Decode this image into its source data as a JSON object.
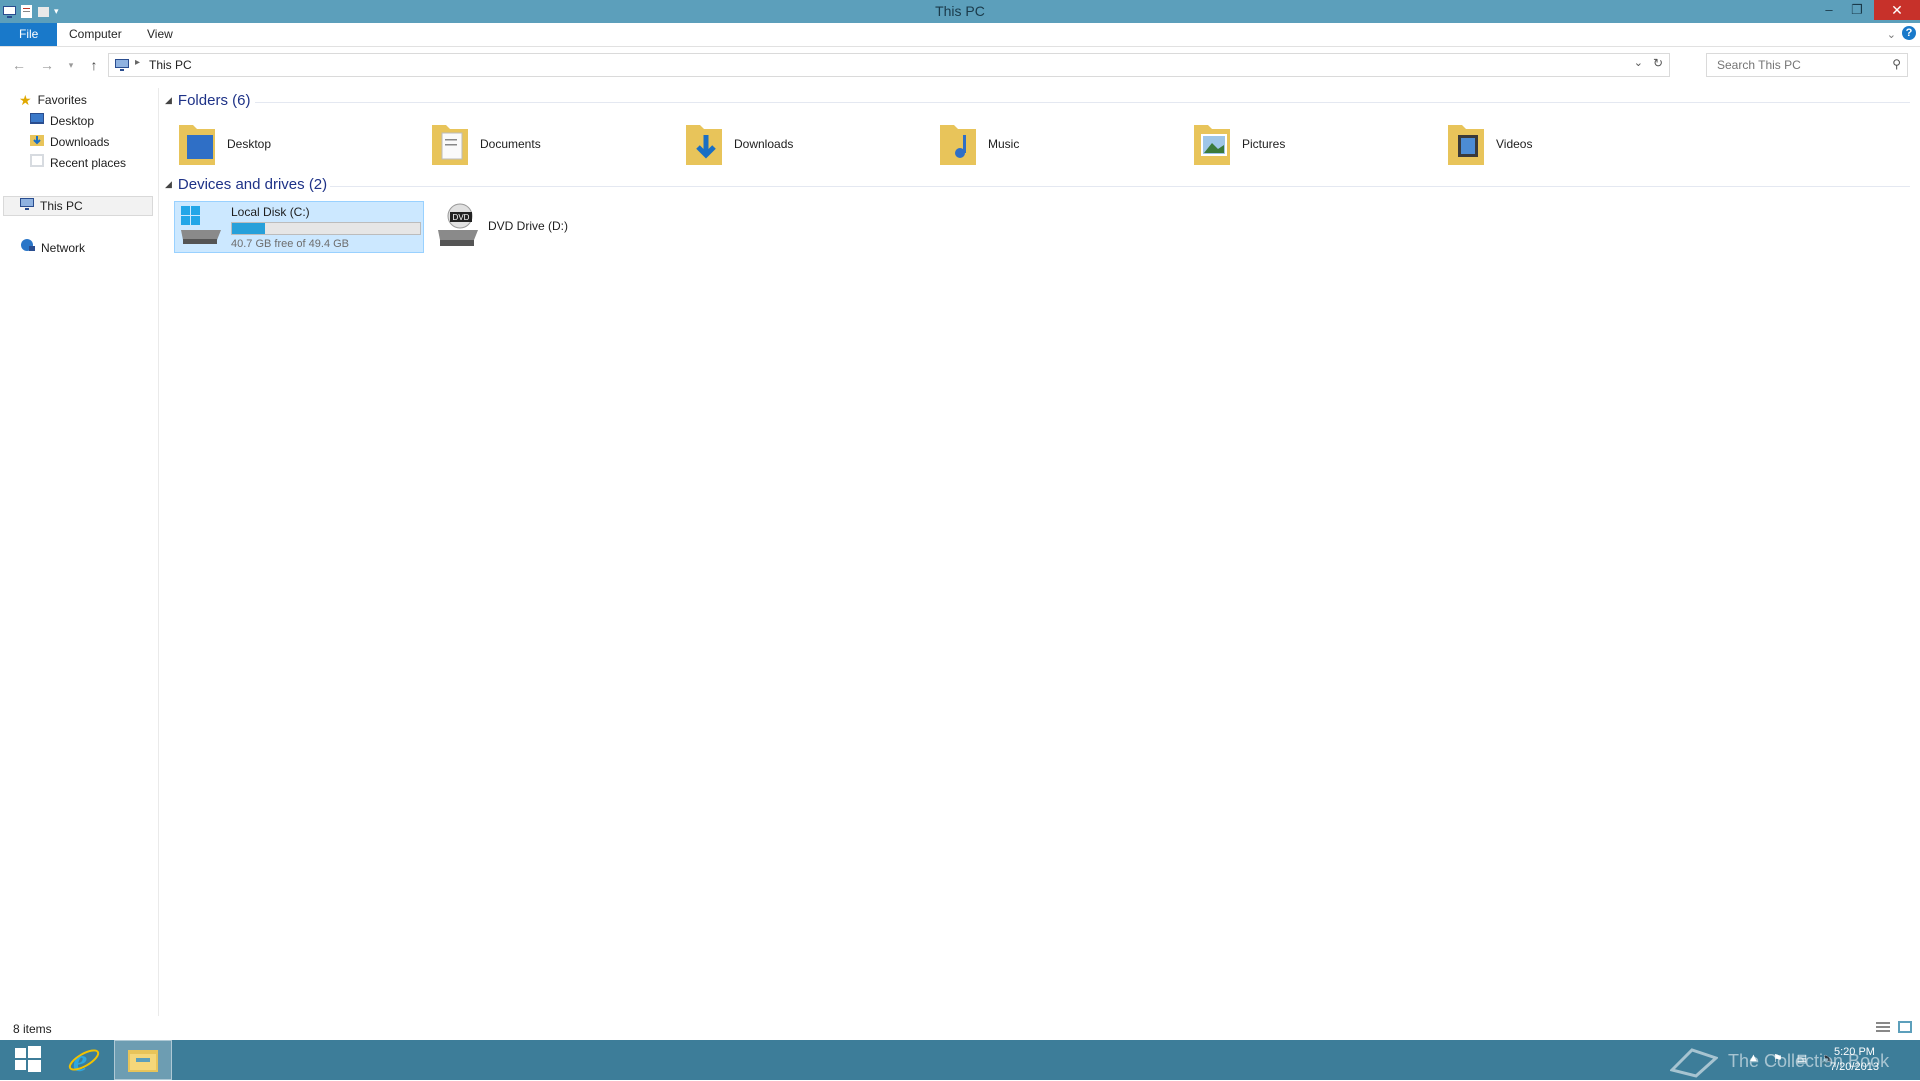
{
  "window": {
    "title": "This PC"
  },
  "ribbon": {
    "tabs": [
      "File",
      "Computer",
      "View"
    ]
  },
  "address": {
    "crumb": "This PC",
    "search_placeholder": "Search This PC"
  },
  "nav": {
    "favorites": "Favorites",
    "favorites_items": [
      "Desktop",
      "Downloads",
      "Recent places"
    ],
    "this_pc": "This PC",
    "network": "Network"
  },
  "folders_group": "Folders (6)",
  "folders": [
    "Desktop",
    "Documents",
    "Downloads",
    "Music",
    "Pictures",
    "Videos"
  ],
  "devices_group": "Devices and drives (2)",
  "drives": {
    "c": {
      "name": "Local Disk (C:)",
      "info": "40.7 GB free of 49.4 GB",
      "used_fraction": 0.176
    },
    "d": {
      "name": "DVD Drive (D:)",
      "badge": "DVD"
    }
  },
  "status": {
    "items": "8 items"
  },
  "taskbar": {
    "watermark": "The Collection Book",
    "time": "5:20 PM",
    "date": "7/20/2013"
  },
  "colors": {
    "titlebar": "#5c9fbb",
    "file_tab": "#1979ca",
    "taskbar": "#3d7d99",
    "group_header": "#1e3287",
    "selection": "#cce8ff"
  }
}
